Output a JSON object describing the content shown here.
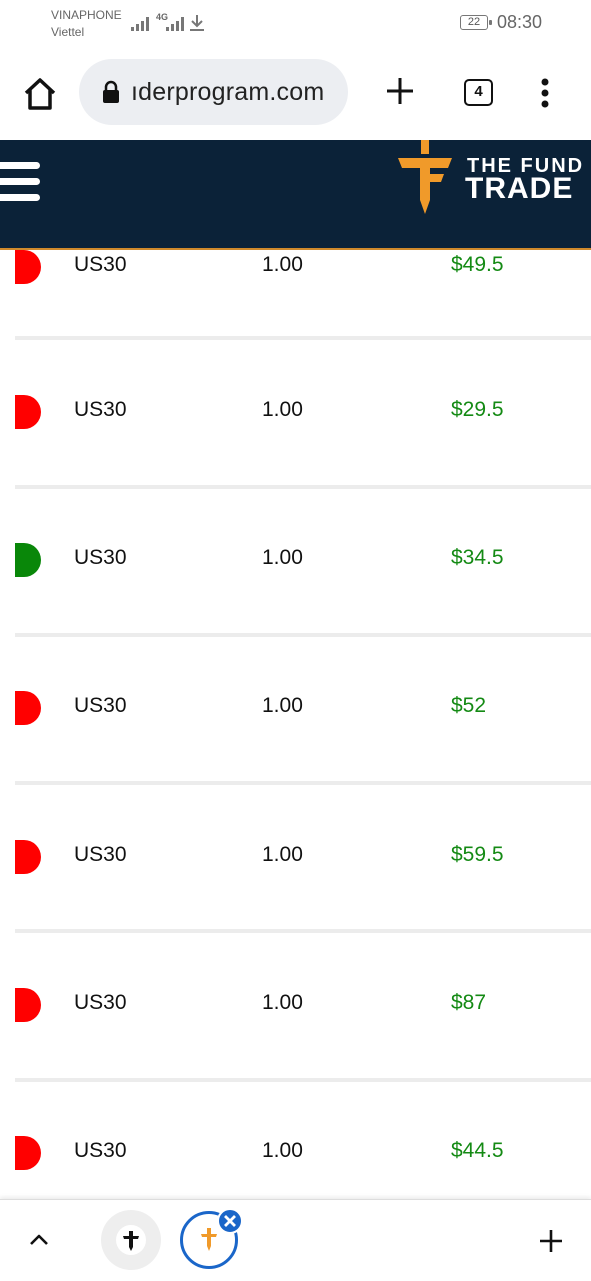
{
  "status_bar": {
    "carrier_primary": "VINAPHONE",
    "carrier_secondary": "Viettel",
    "network_type": "4G",
    "battery_level": "22",
    "time": "08:30"
  },
  "browser": {
    "url": "ıderprogram.com",
    "tab_count": "4"
  },
  "site_header": {
    "brand_line1": "THE FUND",
    "brand_line2": "TRADE",
    "brand_color": "#f09a2a",
    "background": "#0b2238"
  },
  "trades": [
    {
      "symbol": "US30",
      "volume": "1.00",
      "profit": "$49.5",
      "direction": "sell",
      "indicator_color": "#ff0000"
    },
    {
      "symbol": "US30",
      "volume": "1.00",
      "profit": "$29.5",
      "direction": "sell",
      "indicator_color": "#ff0000"
    },
    {
      "symbol": "US30",
      "volume": "1.00",
      "profit": "$34.5",
      "direction": "buy",
      "indicator_color": "#098709"
    },
    {
      "symbol": "US30",
      "volume": "1.00",
      "profit": "$52",
      "direction": "sell",
      "indicator_color": "#ff0000"
    },
    {
      "symbol": "US30",
      "volume": "1.00",
      "profit": "$59.5",
      "direction": "sell",
      "indicator_color": "#ff0000"
    },
    {
      "symbol": "US30",
      "volume": "1.00",
      "profit": "$87",
      "direction": "sell",
      "indicator_color": "#ff0000"
    },
    {
      "symbol": "US30",
      "volume": "1.00",
      "profit": "$44.5",
      "direction": "sell",
      "indicator_color": "#ff0000"
    }
  ],
  "profit_color": "#148a14",
  "icons": {
    "home": "home-icon",
    "lock": "lock-icon",
    "new_tab": "plus-icon",
    "menu": "more-vert-icon",
    "hamburger": "hamburger-menu-icon",
    "up": "chevron-up-icon",
    "close": "close-icon"
  }
}
